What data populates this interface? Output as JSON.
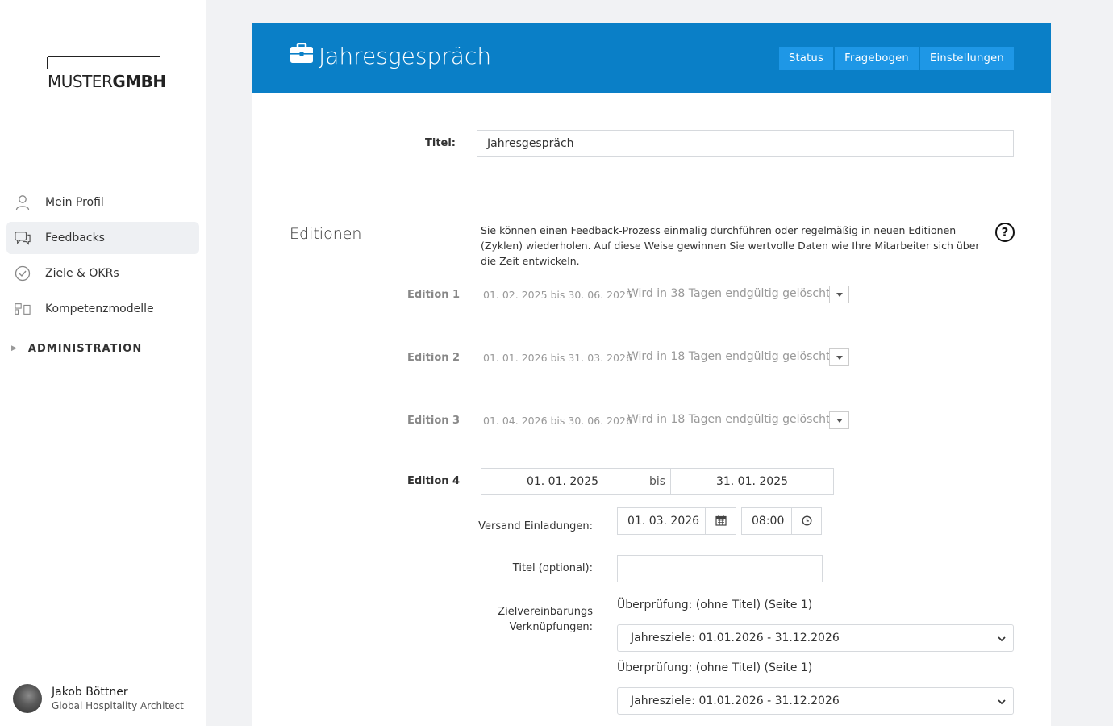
{
  "brand": {
    "logo_light": "MUSTER",
    "logo_bold": "GMBH"
  },
  "sidebar": {
    "items": [
      {
        "label": "Mein Profil",
        "icon": "user-icon",
        "active": false
      },
      {
        "label": "Feedbacks",
        "icon": "chat-icon",
        "active": true
      },
      {
        "label": "Ziele & OKRs",
        "icon": "check-circle-icon",
        "active": false
      },
      {
        "label": "Kompetenzmodelle",
        "icon": "model-icon",
        "active": false
      }
    ],
    "admin_label": "ADMINISTRATION"
  },
  "user": {
    "name": "Jakob Böttner",
    "role": "Global Hospitality Architect"
  },
  "header": {
    "title": "Jahresgespräch",
    "tabs": [
      "Status",
      "Fragebogen",
      "Einstellungen"
    ],
    "color": "#0a7fc7"
  },
  "form": {
    "title_label": "Titel:",
    "title_value": "Jahresgespräch",
    "editionen_heading": "Editionen",
    "editionen_desc": "Sie können einen Feedback-Prozess einmalig durchführen oder regelmäßig in neuen Editionen (Zyklen) wiederholen. Auf diese Weise gewinnen Sie wertvolle Daten wie Ihre Mitarbeiter sich über die Zeit entwickeln.",
    "help_symbol": "?",
    "editions": [
      {
        "label": "Edition 1",
        "dates": "01. 02. 2025 bis 30. 06. 2025",
        "status": "Wird in 38 Tagen endgültig gelöscht"
      },
      {
        "label": "Edition 2",
        "dates": "01. 01. 2026 bis 31. 03. 2026",
        "status": "Wird in 18 Tagen endgültig gelöscht"
      },
      {
        "label": "Edition 3",
        "dates": "01. 04. 2026 bis 30. 06. 2026",
        "status": "Wird in 18 Tagen endgültig gelöscht"
      }
    ],
    "edition4": {
      "label": "Edition 4",
      "from": "01. 01. 2025",
      "bis": "bis",
      "to": "31. 01. 2025",
      "versand_label": "Versand Einladungen:",
      "versand_date": "01. 03. 2026",
      "versand_time": "08:00",
      "titel_optional_label": "Titel (optional):",
      "titel_optional_value": "",
      "ziel_label_1": "Zielvereinbarungs",
      "ziel_label_2": "Verknüpfungen:",
      "links": [
        {
          "heading": "Überprüfung: (ohne Titel) (Seite 1)",
          "selected": "Jahresziele: 01.01.2026 - 31.12.2026"
        },
        {
          "heading": "Überprüfung: (ohne Titel) (Seite 1)",
          "selected": "Jahresziele: 01.01.2026 - 31.12.2026"
        }
      ]
    }
  }
}
